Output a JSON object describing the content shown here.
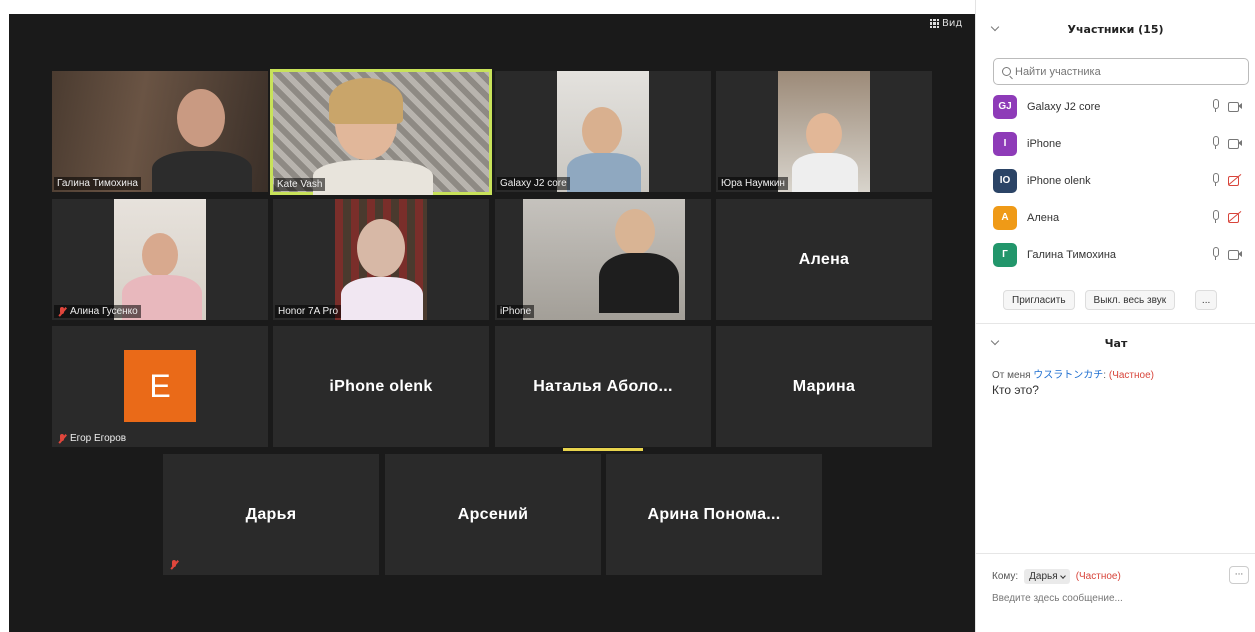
{
  "video": {
    "view_label": "Вид",
    "tiles": [
      {
        "id": "t1",
        "label": "Галина Тимохина",
        "muted": false
      },
      {
        "id": "t2",
        "label": "Kate Vash",
        "muted": false
      },
      {
        "id": "t3",
        "label": "Galaxy J2 core",
        "muted": false
      },
      {
        "id": "t4",
        "label": "Юра Наумкин",
        "muted": false
      },
      {
        "id": "t5",
        "label": "Алина Гусенко",
        "muted": true
      },
      {
        "id": "t6",
        "label": "Honor 7A Pro",
        "muted": false
      },
      {
        "id": "t7",
        "label": "iPhone",
        "muted": false
      },
      {
        "id": "t8",
        "center_name": "Алена"
      },
      {
        "id": "t9",
        "label": "Егор Егоров",
        "muted": true,
        "avatar_letter": "E"
      },
      {
        "id": "t10",
        "center_name": "iPhone olenk"
      },
      {
        "id": "t11",
        "center_name": "Наталья Аболо..."
      },
      {
        "id": "t12",
        "center_name": "Марина"
      },
      {
        "id": "t13",
        "center_name": "Дарья",
        "muted": true
      },
      {
        "id": "t14",
        "center_name": "Арсений"
      },
      {
        "id": "t15",
        "center_name": "Арина Понома..."
      }
    ]
  },
  "participants": {
    "title": "Участники (15)",
    "search_placeholder": "Найти участника",
    "list": [
      {
        "initials": "GJ",
        "name": "Galaxy J2 core",
        "color": "#8e3bb8",
        "cam_off": false
      },
      {
        "initials": "I",
        "name": "iPhone",
        "color": "#8e3bb8",
        "cam_off": false
      },
      {
        "initials": "IO",
        "name": "iPhone olenk",
        "color": "#2b4466",
        "cam_off": true
      },
      {
        "initials": "A",
        "name": "Алена",
        "color": "#ef9a17",
        "cam_off": true
      },
      {
        "initials": "Г",
        "name": "Галина Тимохина",
        "color": "#22966b",
        "cam_off": false
      }
    ],
    "invite_label": "Пригласить",
    "mute_all_label": "Выкл. весь звук",
    "more_label": "..."
  },
  "chat": {
    "title": "Чат",
    "messages": [
      {
        "from_prefix": "От меня",
        "sender": "ウスラトンカチ",
        "private_label": "(Частное)",
        "text": "Кто это?"
      }
    ],
    "to_label": "Кому:",
    "to_value": "Дарья",
    "to_private": "(Частное)",
    "more_label": "···",
    "input_placeholder": "Введите здесь сообщение..."
  },
  "colors": {
    "accent_active": "#c8e25a",
    "speaker_bar": "#e8d44d",
    "avatar_e": "#ea6a18",
    "private_red": "#d8453b"
  }
}
